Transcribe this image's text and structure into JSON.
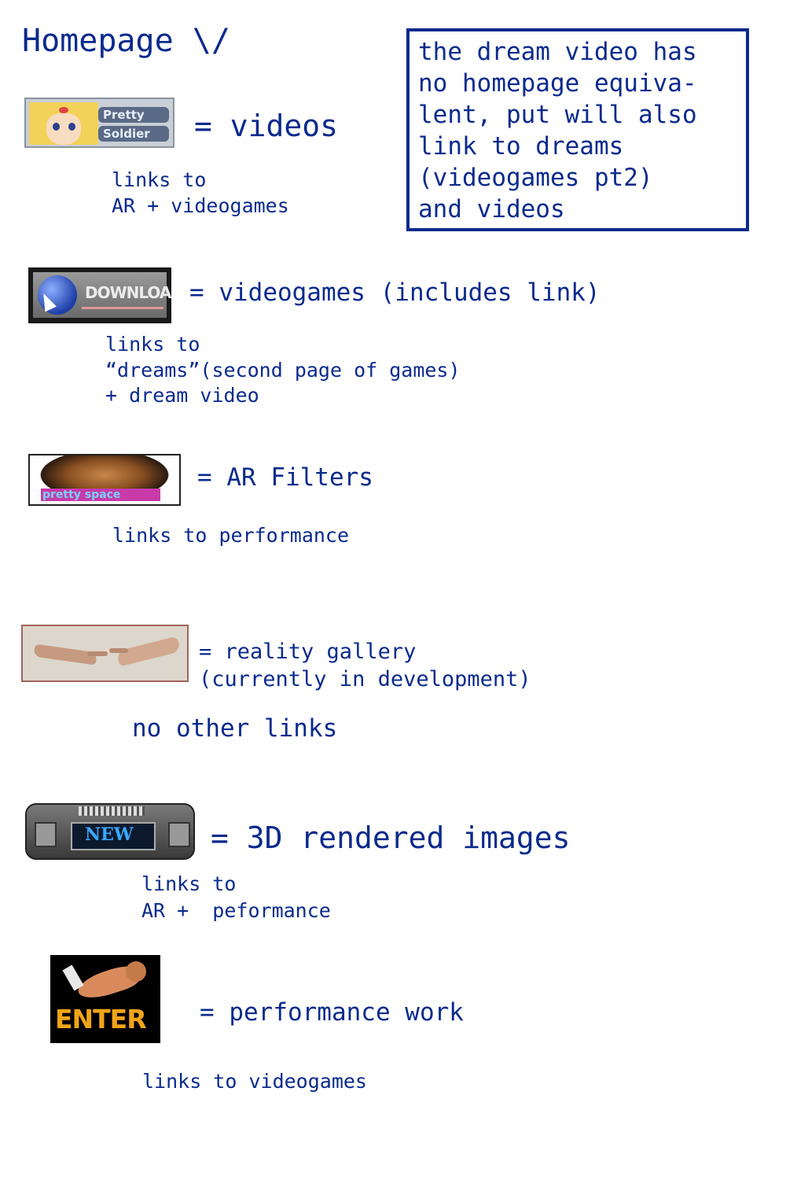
{
  "title": "Homepage \\/",
  "note": {
    "lines": [
      "the dream video has",
      "no homepage equiva-",
      "lent, put will also",
      "link to dreams",
      "(videogames pt2)",
      "and videos"
    ]
  },
  "items": [
    {
      "button_icon": "pretty-soldier-button",
      "button_text": [
        "Pretty",
        "Soldier"
      ],
      "label": "= videos",
      "links": [
        "links to",
        "AR + videogames"
      ]
    },
    {
      "button_icon": "download-button",
      "button_text": [
        "DOWNLOAD"
      ],
      "label": "= videogames (includes link)",
      "links": [
        "links to",
        "“dreams”(second page of games)",
        "+ dream video"
      ]
    },
    {
      "button_icon": "pretty-space-button",
      "button_text": [
        "pretty space"
      ],
      "label": "= AR Filters",
      "links": [
        "links to performance"
      ]
    },
    {
      "button_icon": "creation-of-adam-hands-button",
      "button_text": [],
      "label": [
        "= reality gallery",
        "(currently in development)"
      ],
      "links": [
        "no other links"
      ]
    },
    {
      "button_icon": "new-button",
      "button_text": [
        "NEW"
      ],
      "label": "= 3D rendered images",
      "links": [
        "links to",
        "AR +  peformance"
      ]
    },
    {
      "button_icon": "enter-button",
      "button_text": [
        "ENTER"
      ],
      "label": "= performance work",
      "links": [
        "links to videogames"
      ]
    }
  ],
  "colors": {
    "text": "#0a2a8c",
    "background": "#ffffff"
  }
}
